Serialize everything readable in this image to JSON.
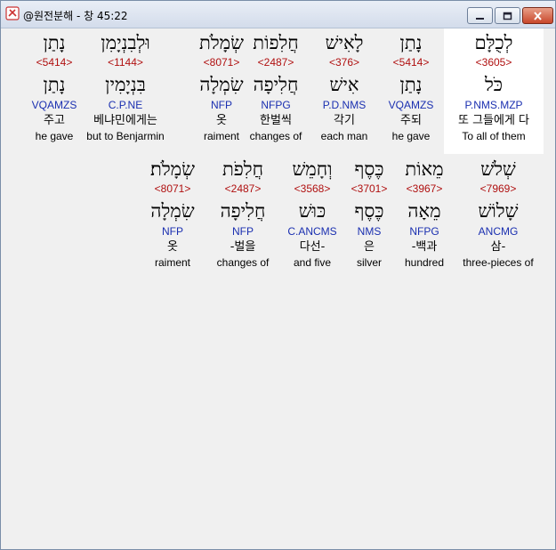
{
  "window": {
    "title": "@원전분해 - 창 45:22",
    "buttons": {
      "minimize": "minimize-icon",
      "maximize": "maximize-icon",
      "close": "close-icon"
    }
  },
  "colors": {
    "strong": "#b01010",
    "grammar": "#1a2fb0",
    "highlight": "#ffffff"
  },
  "rows": [
    {
      "words": [
        {
          "heb": "נָתַן",
          "str": "<5414>",
          "root": "נָתַן",
          "gram": "VQAMZS",
          "kor": "주고",
          "eng": "he gave"
        },
        {
          "heb": "וּלְבִנְיָמִן",
          "str": "<1144>",
          "root": "בִּנְיָמִין",
          "gram": "C.P.NE",
          "kor": "베냐민에게는",
          "eng": "but to Benjarmin"
        },
        {
          "heb": "שְׂמָלֹת",
          "str": "<8071>",
          "root": "שִׂמְלָה",
          "gram": "NFP",
          "kor": "옷",
          "eng": "raiment"
        },
        {
          "heb": "חֲלִפוֹת",
          "str": "<2487>",
          "root": "חֲלִיפָה",
          "gram": "NFPG",
          "kor": "한벌씩",
          "eng": "changes of"
        },
        {
          "heb": "לָאִישׁ",
          "str": "<376>",
          "root": "אִישׁ",
          "gram": "P.D.NMS",
          "kor": "각기",
          "eng": "each man"
        },
        {
          "heb": "נָתַן",
          "str": "<5414>",
          "root": "נָתַן",
          "gram": "VQAMZS",
          "kor": "주되",
          "eng": "he gave"
        },
        {
          "heb": "לְכֻלָּם",
          "str": "<3605>",
          "root": "כֹּל",
          "gram": "P.NMS.MZP",
          "kor": "또 그들에게 다",
          "eng": "To all of them"
        }
      ]
    },
    {
      "words": [
        {
          "heb": "שְׂמָלֹת׃",
          "str": "<8071>",
          "root": "שִׂמְלָה",
          "gram": "NFP",
          "kor": "옷",
          "eng": "raiment"
        },
        {
          "heb": "חֲלִפֹת",
          "str": "<2487>",
          "root": "חֲלִיפָה",
          "gram": "NFP",
          "kor": "-벌을",
          "eng": "changes of"
        },
        {
          "heb": "וְחָמֵשׁ",
          "str": "<3568>",
          "root": "כּוּשׁ",
          "gram": "C.ANCMS",
          "kor": "다선-",
          "eng": "and five"
        },
        {
          "heb": "כֶּסֶף",
          "str": "<3701>",
          "root": "כֶּסֶף",
          "gram": "NMS",
          "kor": "은",
          "eng": "silver"
        },
        {
          "heb": "מֵאוֹת",
          "str": "<3967>",
          "root": "מֵאָה",
          "gram": "NFPG",
          "kor": "-백과",
          "eng": "hundred"
        },
        {
          "heb": "שְׁלֹשׁ",
          "str": "<7969>",
          "root": "שָׁלוֹשׁ",
          "gram": "ANCMG",
          "kor": "삼-",
          "eng": "three-pieces of"
        }
      ]
    }
  ]
}
